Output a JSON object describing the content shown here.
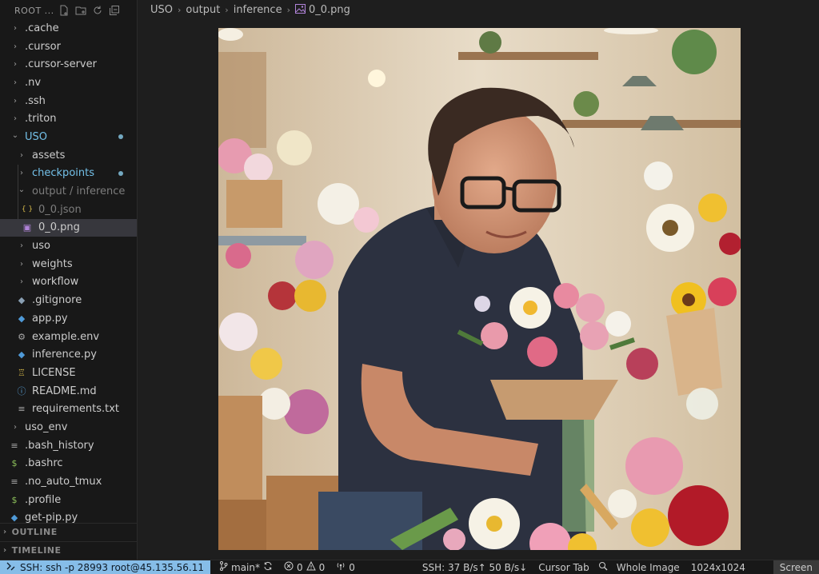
{
  "sidebar": {
    "title": "ROOT ...",
    "header_icons": [
      "new-file-icon",
      "new-folder-icon",
      "refresh-icon",
      "collapse-all-icon"
    ],
    "items": [
      {
        "label": ".cache",
        "type": "folder",
        "depth": 0,
        "expanded": false
      },
      {
        "label": ".cursor",
        "type": "folder",
        "depth": 0,
        "expanded": false
      },
      {
        "label": ".cursor-server",
        "type": "folder",
        "depth": 0,
        "expanded": false
      },
      {
        "label": ".nv",
        "type": "folder",
        "depth": 0,
        "expanded": false
      },
      {
        "label": ".ssh",
        "type": "folder",
        "depth": 0,
        "expanded": false
      },
      {
        "label": ".triton",
        "type": "folder",
        "depth": 0,
        "expanded": false
      },
      {
        "label": "USO",
        "type": "folder",
        "depth": 0,
        "expanded": true,
        "modified": true
      },
      {
        "label": "assets",
        "type": "folder",
        "depth": 1,
        "expanded": false
      },
      {
        "label": "checkpoints",
        "type": "folder",
        "depth": 1,
        "expanded": false,
        "modified": true
      },
      {
        "label": "output / inference",
        "type": "folder",
        "depth": 1,
        "expanded": true,
        "dim": true
      },
      {
        "label": "0_0.json",
        "type": "json",
        "depth": 2,
        "dim": true
      },
      {
        "label": "0_0.png",
        "type": "png",
        "depth": 2,
        "selected": true
      },
      {
        "label": "uso",
        "type": "folder",
        "depth": 1,
        "expanded": false
      },
      {
        "label": "weights",
        "type": "folder",
        "depth": 1,
        "expanded": false
      },
      {
        "label": "workflow",
        "type": "folder",
        "depth": 1,
        "expanded": false
      },
      {
        "label": ".gitignore",
        "type": "gitignore",
        "depth": 1
      },
      {
        "label": "app.py",
        "type": "python",
        "depth": 1
      },
      {
        "label": "example.env",
        "type": "gear",
        "depth": 1
      },
      {
        "label": "inference.py",
        "type": "python",
        "depth": 1
      },
      {
        "label": "LICENSE",
        "type": "license",
        "depth": 1
      },
      {
        "label": "README.md",
        "type": "info",
        "depth": 1
      },
      {
        "label": "requirements.txt",
        "type": "text",
        "depth": 1
      },
      {
        "label": "uso_env",
        "type": "folder",
        "depth": 0,
        "expanded": false
      },
      {
        "label": ".bash_history",
        "type": "text",
        "depth": 0
      },
      {
        "label": ".bashrc",
        "type": "shell",
        "depth": 0
      },
      {
        "label": ".no_auto_tmux",
        "type": "text",
        "depth": 0
      },
      {
        "label": ".profile",
        "type": "shell",
        "depth": 0
      },
      {
        "label": "get-pip.py",
        "type": "python",
        "depth": 0
      }
    ],
    "sections": {
      "outline": "OUTLINE",
      "timeline": "TIMELINE"
    }
  },
  "breadcrumb": [
    "USO",
    "output",
    "inference",
    "0_0.png"
  ],
  "statusbar": {
    "remote": "SSH: ssh -p 28993 root@45.135.56.11",
    "branch": "main*",
    "errors": "0",
    "warnings": "0",
    "ports": "0",
    "ssh_rate": "SSH: 37 B/s↑ 50 B/s↓",
    "cursor_tab": "Cursor Tab",
    "view_mode": "Whole Image",
    "image_size": "1024x1024",
    "screen": "Screen"
  },
  "colors": {
    "accent_remote": "#86bde8",
    "modified_text": "#73c0e8",
    "selected_row": "#37373d",
    "image_file_icon": "#b083d8"
  }
}
